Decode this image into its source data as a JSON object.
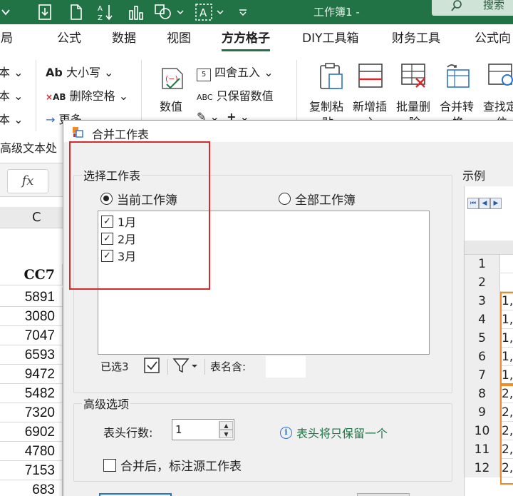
{
  "titlebar": {
    "title": "工作簿1",
    "separator": "-",
    "search_label": "搜索"
  },
  "ribbon_tabs": [
    "布局",
    "公式",
    "数据",
    "视图",
    "方方格子",
    "DIY工具箱",
    "财务工具",
    "公式向"
  ],
  "ribbon": {
    "left_items": [
      "本",
      "本",
      "本"
    ],
    "case_label": "大小写",
    "delete_space_label": "删除空格",
    "more_label": "更多",
    "round_label": "四舍五入",
    "keep_value_label": "只保留数值",
    "numeric_label": "数值",
    "copy_paste_label": "复制粘",
    "copy_paste_label2": "贴",
    "insert_label": "新增插",
    "insert_label2": "入",
    "batch_delete_label": "批量删",
    "batch_delete_label2": "除",
    "merge_label": "合并转",
    "merge_label2": "换",
    "lookup_label": "查找定",
    "lookup_label2": "位",
    "advanced_text_label": "高级文本处"
  },
  "sheet": {
    "fx": "fx",
    "column_letter": "C",
    "header_cell": "CC7",
    "values": [
      "5891",
      "3080",
      "7047",
      "6593",
      "9472",
      "5482",
      "7320",
      "6902",
      "4780",
      "7153",
      "683"
    ]
  },
  "dialog": {
    "title": "合并工作表",
    "select_group": "选择工作表",
    "radio_current": "当前工作簿",
    "radio_all": "全部工作簿",
    "sheets": [
      {
        "name": "1月",
        "checked": true
      },
      {
        "name": "2月",
        "checked": true
      },
      {
        "name": "3月",
        "checked": true
      }
    ],
    "selected_count": "已选3",
    "name_contains": "表名含:",
    "advanced_group": "高级选项",
    "header_rows_label": "表头行数:",
    "header_rows_value": "1",
    "info_text": "表头将只保留一个",
    "mark_source_label": "合并后，标注源工作表",
    "example_label": "示例",
    "example_rows": [
      {
        "n": "1",
        "v": ""
      },
      {
        "n": "2",
        "v": ""
      },
      {
        "n": "3",
        "v": "1,"
      },
      {
        "n": "4",
        "v": "1,"
      },
      {
        "n": "5",
        "v": "1,"
      },
      {
        "n": "6",
        "v": "1,"
      },
      {
        "n": "7",
        "v": "1,"
      },
      {
        "n": "8",
        "v": "2,"
      },
      {
        "n": "9",
        "v": "2,"
      },
      {
        "n": "10",
        "v": "2,"
      },
      {
        "n": "11",
        "v": "2,"
      },
      {
        "n": "12",
        "v": "2,"
      }
    ]
  },
  "colors": {
    "excel_green": "#217346",
    "highlight_red": "#d9292b",
    "orange": "#f08a24",
    "accent_blue": "#2b73c9"
  }
}
